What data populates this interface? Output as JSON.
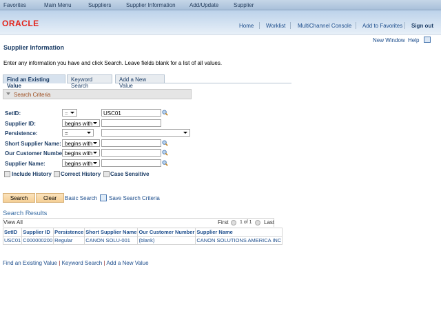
{
  "topbar": {
    "favorites": "Favorites",
    "main_menu": "Main Menu",
    "breadcrumb": [
      "Suppliers",
      "Supplier Information",
      "Add/Update",
      "Supplier"
    ]
  },
  "header": {
    "logo": "ORACLE",
    "links": [
      "Home",
      "Worklist",
      "MultiChannel Console",
      "Add to Favorites",
      "Sign out"
    ]
  },
  "utility": {
    "new_window": "New Window",
    "help": "Help"
  },
  "page": {
    "title": "Supplier Information",
    "instructions": "Enter any information you have and click Search. Leave fields blank for a list of all values."
  },
  "tabs": [
    "Find an Existing Value",
    "Keyword Search",
    "Add a New Value"
  ],
  "criteria": {
    "header": "Search Criteria",
    "fields": [
      {
        "label": "SetID:",
        "operator": "=",
        "value": "USC01"
      },
      {
        "label": "Supplier ID:",
        "operator": "begins with",
        "value": ""
      },
      {
        "label": "Persistence:",
        "operator": "=",
        "value": ""
      },
      {
        "label": "Short Supplier Name:",
        "operator": "begins with",
        "value": ""
      },
      {
        "label": "Our Customer Number:",
        "operator": "begins with",
        "value": ""
      },
      {
        "label": "Supplier Name:",
        "operator": "begins with",
        "value": ""
      }
    ],
    "checkboxes": [
      "Include History",
      "Correct History",
      "Case Sensitive"
    ]
  },
  "actions": {
    "search": "Search",
    "clear": "Clear",
    "basic_search": "Basic Search",
    "save_criteria": "Save Search Criteria"
  },
  "results": {
    "title": "Search Results",
    "view_all": "View All",
    "first": "First",
    "page_info": "1 of 1",
    "last": "Last",
    "columns": [
      "SetID",
      "Supplier ID",
      "Persistence",
      "Short Supplier Name",
      "Our Customer Number",
      "Supplier Name"
    ],
    "rows": [
      [
        "USC01",
        "C000000200",
        "Regular",
        "CANON SOLU-001",
        "(blank)",
        "CANON SOLUTIONS AMERICA INC"
      ]
    ]
  },
  "footer_links": [
    "Find an Existing Value",
    "Keyword Search",
    "Add a New Value"
  ]
}
